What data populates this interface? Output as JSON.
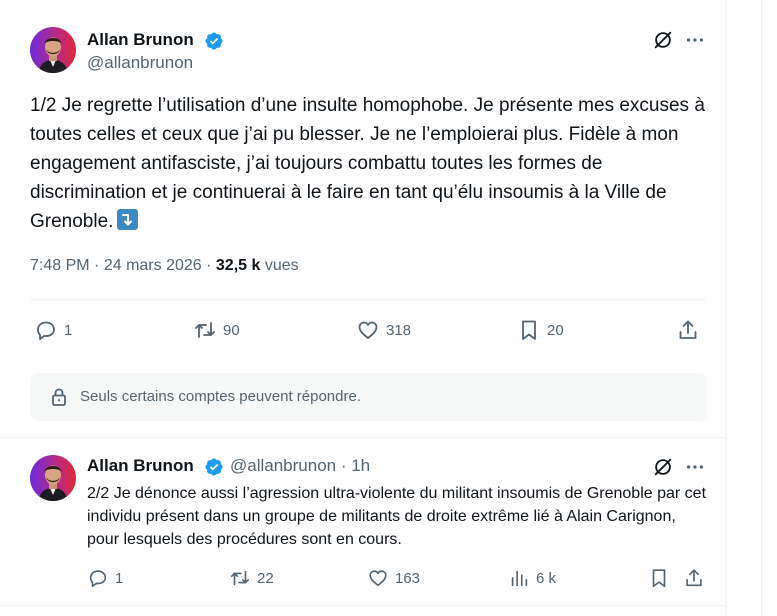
{
  "tweet": {
    "author_name": "Allan Brunon",
    "handle": "@allanbrunon",
    "text": "1/2 Je regrette l’utilisation d’une insulte homophobe. Je présente mes excuses à toutes celles et ceux que j’ai pu blesser. Je ne l’emploierai plus. Fidèle à mon engagement antifasciste, j’ai toujours combattu toutes les formes de discrimination et je continuerai à le faire en tant qu’élu insoumis à la Ville de Grenoble.",
    "emoji_icon": "arrow-right-down-emoji",
    "time": "7:48 PM",
    "date": "24 mars 2026",
    "view_count": "32,5 k",
    "views_label": "vues",
    "actions": {
      "replies": "1",
      "reposts": "90",
      "likes": "318",
      "bookmarks": "20"
    },
    "reply_restriction": "Seuls certains comptes peuvent répondre."
  },
  "reply": {
    "author_name": "Allan Brunon",
    "handle_time": "@allanbrunon · 1h",
    "text": "2/2 Je dénonce aussi l’agression ultra-violente du militant insoumis de Grenoble par cet individu présent dans un groupe de militants de droite extrême lié à Alain Carignon, pour lesquels des procédures sont en cours.",
    "actions": {
      "replies": "1",
      "reposts": "22",
      "likes": "163",
      "views": "6 k"
    }
  },
  "colors": {
    "text": "#0f1419",
    "secondary": "#536471",
    "verified": "#1d9bf0",
    "divider": "#eff3f4",
    "reply_box_bg": "#f7f9f9"
  }
}
